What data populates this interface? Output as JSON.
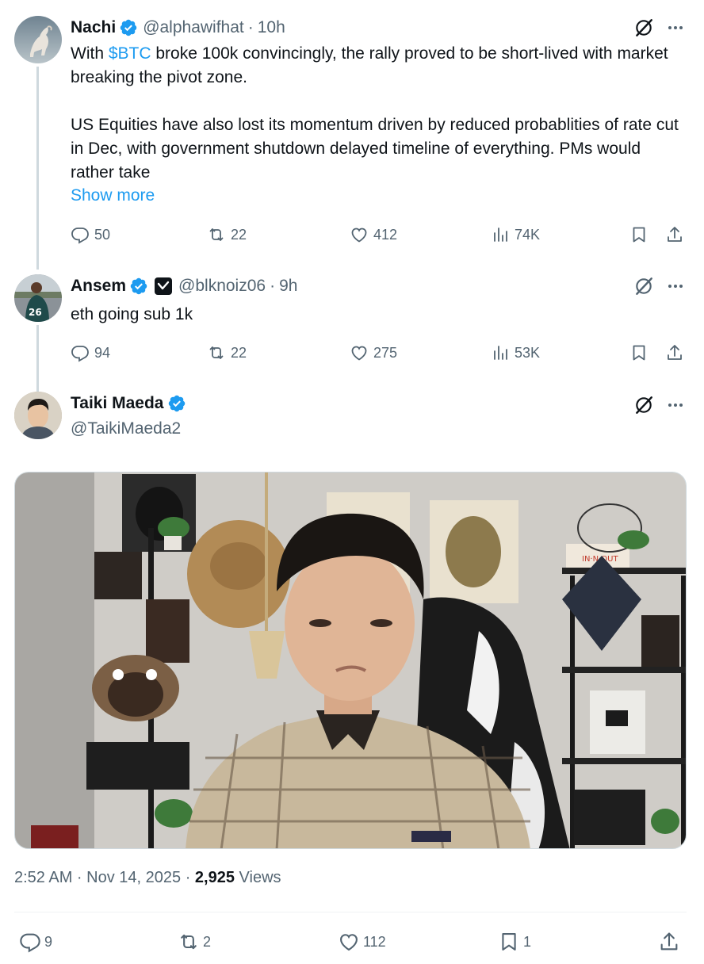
{
  "tweets": [
    {
      "name": "Nachi",
      "handle": "@alphawifhat",
      "time": "10h",
      "text_before_tag": "With ",
      "cashtag": "$BTC",
      "text_after_tag": " broke 100k convincingly, the rally proved to be short-lived with market breaking the pivot zone.",
      "text_p2": "US Equities have also lost its momentum driven by reduced probablities of rate cut in Dec, with government shutdown delayed timeline of everything. PMs would rather take",
      "show_more": "Show more",
      "replies": "50",
      "reposts": "22",
      "likes": "412",
      "views": "74K"
    },
    {
      "name": "Ansem",
      "handle": "@blknoiz06",
      "time": "9h",
      "text": "eth going sub 1k",
      "replies": "94",
      "reposts": "22",
      "likes": "275",
      "views": "53K"
    }
  ],
  "main_tweet": {
    "name": "Taiki Maeda",
    "handle": "@TaikiMaeda2",
    "timestamp": "2:52 AM · Nov 14, 2025",
    "views_count": "2,925",
    "views_label": "Views",
    "replies": "9",
    "reposts": "2",
    "likes": "112",
    "bookmarks": "1"
  },
  "colors": {
    "accent": "#1d9bf0",
    "secondary_text": "#536471",
    "primary_text": "#0f1419",
    "thread_line": "#cfd9de"
  }
}
